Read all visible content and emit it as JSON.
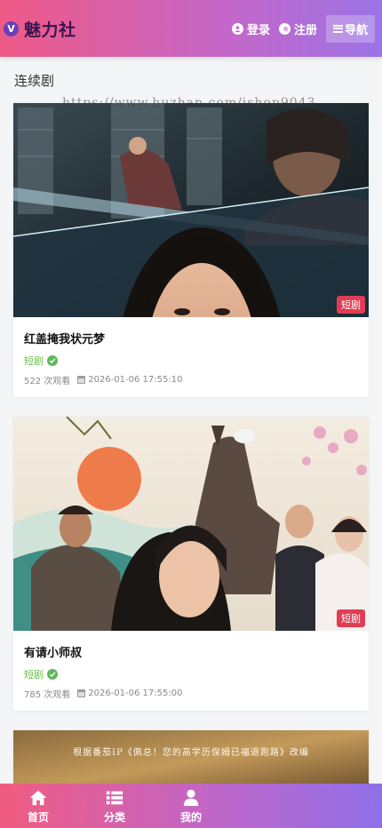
{
  "header": {
    "logo_letter": "V",
    "logo_text": "魅力社",
    "login_label": "登录",
    "register_label": "注册",
    "nav_label": "导航"
  },
  "section": {
    "title": "连续剧"
  },
  "watermark": "https://www.huzhan.com/ishop9043",
  "cards": [
    {
      "title": "红盖掩我状元梦",
      "category": "短剧",
      "tag": "短剧",
      "views": "522 次观看",
      "date": "2026-01-06 17:55:10"
    },
    {
      "title": "有请小师叔",
      "category": "短剧",
      "tag": "短剧",
      "views": "785 次观看",
      "date": "2026-01-06 17:55:00"
    },
    {
      "poster_text": "根据番茄IP《佩总！您的高学历保姆已福退跑路》改编"
    }
  ],
  "tabbar": {
    "home_label": "首页",
    "category_label": "分类",
    "mine_label": "我的"
  },
  "colors": {
    "header_start": "#ef5a86",
    "header_end": "#9b74e6",
    "tag_bg": "#e03d54",
    "category_green": "#6cbf4b"
  }
}
